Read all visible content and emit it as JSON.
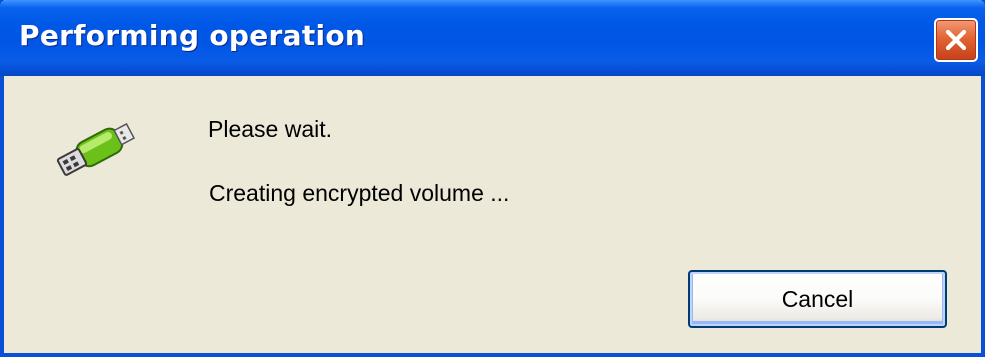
{
  "window": {
    "title": "Performing operation",
    "close_icon": "close-icon",
    "accent_color": "#0055e5"
  },
  "content": {
    "icon": "usb-drive-key-icon",
    "message_primary": "Please wait.",
    "message_secondary": "Creating encrypted volume ..."
  },
  "buttons": {
    "cancel_label": "Cancel"
  }
}
